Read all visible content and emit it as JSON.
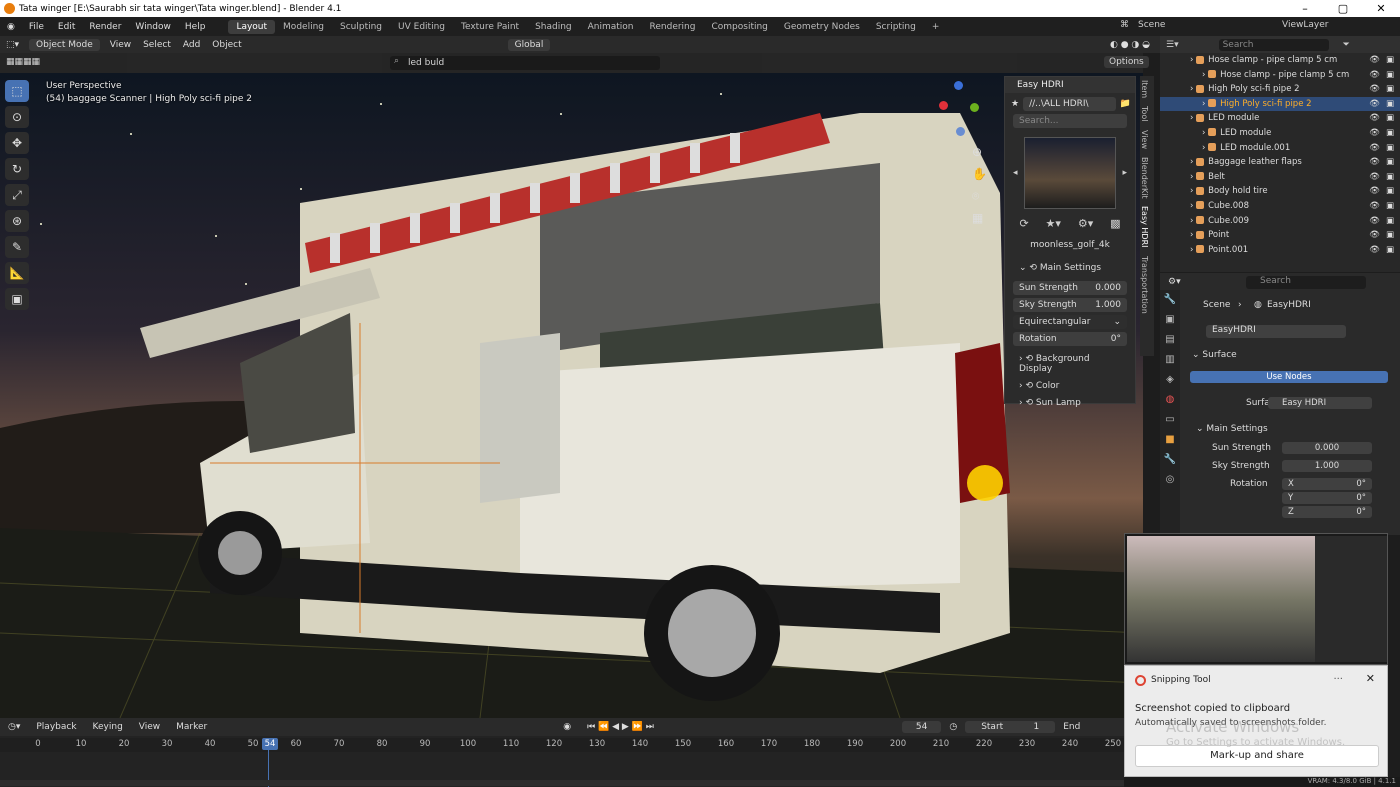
{
  "title": "Tata winger [E:\\Saurabh sir tata winger\\Tata winger.blend] - Blender 4.1",
  "menu": [
    "File",
    "Edit",
    "Render",
    "Window",
    "Help"
  ],
  "workspaces": [
    "Layout",
    "Modeling",
    "Sculpting",
    "UV Editing",
    "Texture Paint",
    "Shading",
    "Animation",
    "Rendering",
    "Compositing",
    "Geometry Nodes",
    "Scripting"
  ],
  "active_workspace": "Layout",
  "scene": "Scene",
  "view_layer": "ViewLayer",
  "viewport_header": {
    "mode": "Object Mode",
    "items": [
      "View",
      "Select",
      "Add",
      "Object"
    ],
    "transform": "Global",
    "search": "led buld",
    "options": "Options"
  },
  "viewport_info": {
    "perspective": "User Perspective",
    "object": "(54) baggage Scanner | High Poly sci-fi pipe 2"
  },
  "easy_hdri": {
    "title": "Easy HDRI",
    "path": "//..\\ALL HDRI\\",
    "search_placeholder": "Search...",
    "hdri_name": "moonless_golf_4k",
    "main_settings": "Main Settings",
    "sun_strength_label": "Sun Strength",
    "sun_strength": "0.000",
    "sky_strength_label": "Sky Strength",
    "sky_strength": "1.000",
    "projection": "Equirectangular",
    "rotation_label": "Rotation",
    "rotation": "0°",
    "subpanels": [
      "Background Display",
      "Color",
      "Sun Lamp"
    ]
  },
  "side_tabs": [
    "Item",
    "Tool",
    "View",
    "BlenderKit",
    "Easy HDRI",
    "Transportation"
  ],
  "outliner": {
    "search_placeholder": "Search",
    "rows": [
      {
        "name": "Hose clamp - pipe clamp 5 cm",
        "indent": 2,
        "color": "#e59f5a"
      },
      {
        "name": "Hose clamp - pipe clamp 5 cm",
        "indent": 3,
        "color": "#e59f5a"
      },
      {
        "name": "High Poly sci-fi pipe 2",
        "indent": 2,
        "color": "#e59f5a"
      },
      {
        "name": "High Poly sci-fi pipe 2",
        "indent": 3,
        "color": "#e59f5a",
        "selected": true
      },
      {
        "name": "LED module",
        "indent": 2,
        "color": "#e59f5a"
      },
      {
        "name": "LED module",
        "indent": 3,
        "color": "#e59f5a"
      },
      {
        "name": "LED module.001",
        "indent": 3,
        "color": "#e59f5a"
      },
      {
        "name": "Baggage leather flaps",
        "indent": 2,
        "color": "#e59f5a"
      },
      {
        "name": "Belt",
        "indent": 2,
        "color": "#e59f5a"
      },
      {
        "name": "Body hold tire",
        "indent": 2,
        "color": "#e59f5a"
      },
      {
        "name": "Cube.008",
        "indent": 2,
        "color": "#e59f5a"
      },
      {
        "name": "Cube.009",
        "indent": 2,
        "color": "#e59f5a"
      },
      {
        "name": "Point",
        "indent": 2,
        "color": "#e59f5a"
      },
      {
        "name": "Point.001",
        "indent": 2,
        "color": "#e59f5a"
      }
    ]
  },
  "properties": {
    "search_placeholder": "Search",
    "breadcrumb_scene": "Scene",
    "breadcrumb_world": "EasyHDRI",
    "world_name": "EasyHDRI",
    "surface_panel": "Surface",
    "use_nodes": "Use Nodes",
    "surface_label": "Surface",
    "surface_value": "Easy HDRI",
    "main_settings": "Main Settings",
    "sun_strength_label": "Sun Strength",
    "sun_strength": "0.000",
    "sky_strength_label": "Sky Strength",
    "sky_strength": "1.000",
    "rotation_label": "Rotation",
    "x_label": "X",
    "x": "0°",
    "y_label": "Y",
    "y": "0°",
    "z_label": "Z",
    "z": "0°"
  },
  "timeline": {
    "menus": [
      "Playback",
      "Keying",
      "View",
      "Marker"
    ],
    "current_frame": "54",
    "start_label": "Start",
    "start": "1",
    "end_label": "End",
    "ticks": [
      "0",
      "10",
      "20",
      "30",
      "40",
      "50",
      "60",
      "70",
      "80",
      "90",
      "100",
      "110",
      "120",
      "130",
      "140",
      "150",
      "160",
      "170",
      "180",
      "190",
      "200",
      "210",
      "220",
      "230",
      "240",
      "250"
    ]
  },
  "snipping": {
    "app": "Snipping Tool",
    "message": "Screenshot copied to clipboard",
    "sub": "Automatically saved to screenshots folder.",
    "button": "Mark-up and share"
  },
  "watermark": {
    "line1": "Activate Windows",
    "line2": "Go to Settings to activate Windows."
  },
  "status": "VRAM: 4.3/8.0 GiB | 4.1.1"
}
